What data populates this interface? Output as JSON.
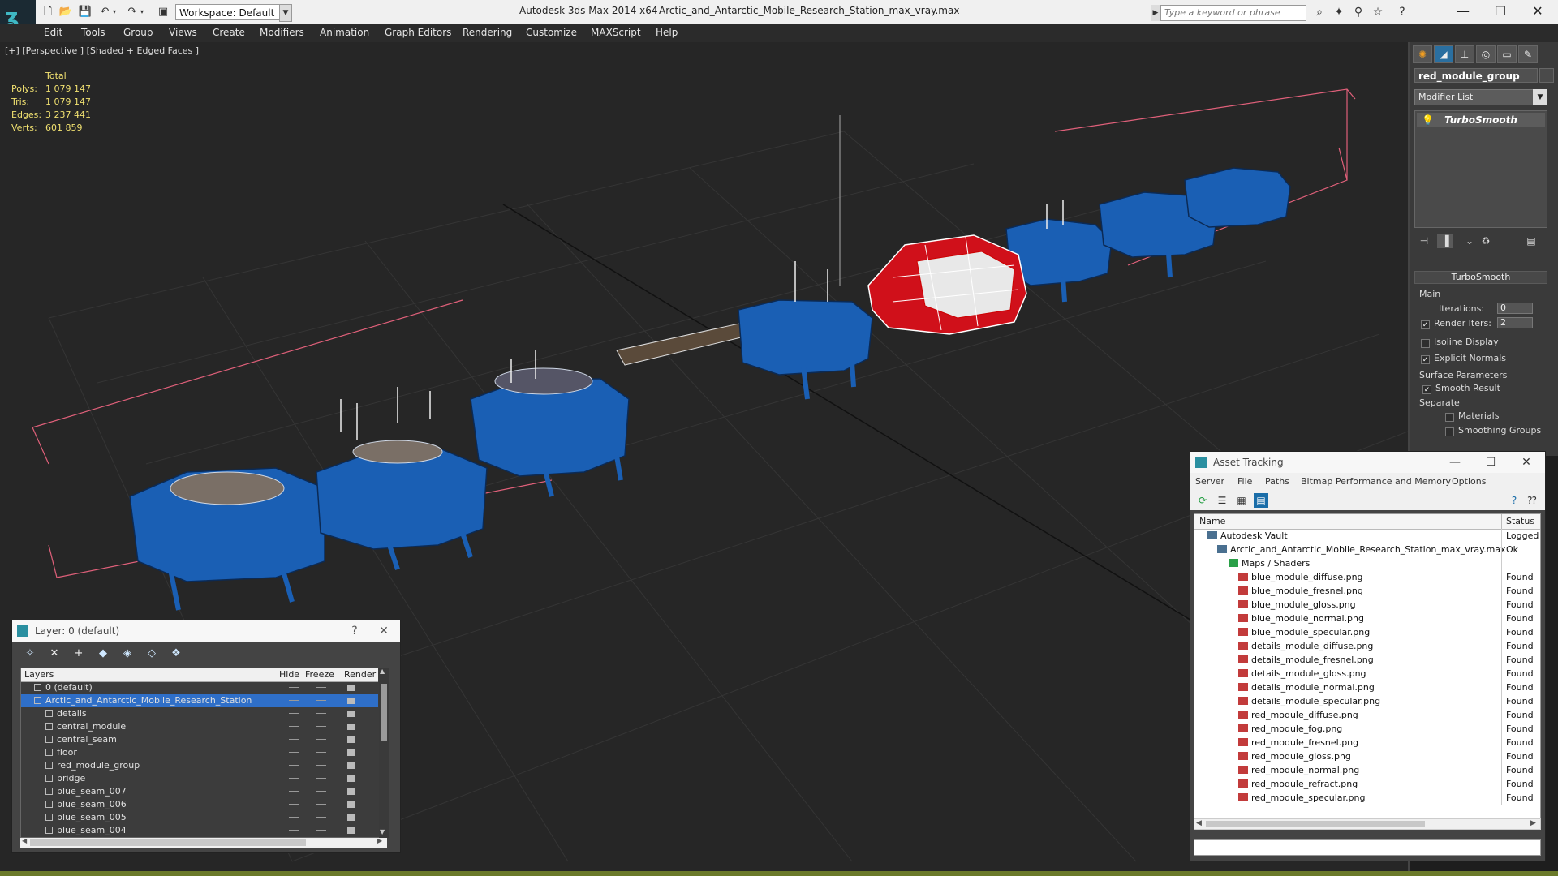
{
  "titlebar": {
    "workspace": "Workspace: Default",
    "app_title": "Autodesk 3ds Max  2014 x64",
    "doc_title": "Arctic_and_Antarctic_Mobile_Research_Station_max_vray.max",
    "search_placeholder": "Type a keyword or phrase",
    "minimize": "—",
    "maximize": "☐",
    "close": "✕"
  },
  "menu": [
    "Edit",
    "Tools",
    "Group",
    "Views",
    "Create",
    "Modifiers",
    "Animation",
    "Graph Editors",
    "Rendering",
    "Customize",
    "MAXScript",
    "Help"
  ],
  "viewport": {
    "label": "[+] [Perspective ] [Shaded + Edged Faces ]",
    "stats_header": "Total",
    "stats": [
      {
        "label": "Polys:",
        "value": "1 079 147"
      },
      {
        "label": "Tris:",
        "value": "1 079 147"
      },
      {
        "label": "Edges:",
        "value": "3 237 441"
      },
      {
        "label": "Verts:",
        "value": "601 859"
      }
    ],
    "colors": {
      "blue_module": "#1a5fb4",
      "red_module": "#d0101a",
      "selection_box": "#e0607a",
      "grid": "#3a3a3a"
    }
  },
  "command_panel": {
    "object_name": "red_module_group",
    "modifier_list": "Modifier List",
    "stack_item": "TurboSmooth",
    "rollout_title": "TurboSmooth",
    "main_group": "Main",
    "iterations_label": "Iterations:",
    "iterations_value": "0",
    "render_iters_label": "Render Iters:",
    "render_iters_value": "2",
    "isoline_label": "Isoline Display",
    "explicit_normals_label": "Explicit Normals",
    "surface_group": "Surface Parameters",
    "smooth_result_label": "Smooth Result",
    "separate_label": "Separate",
    "materials_label": "Materials",
    "smoothing_groups_label": "Smoothing Groups"
  },
  "asset_tracking": {
    "title": "Asset Tracking",
    "menu": [
      "Server",
      "File",
      "Paths",
      "Bitmap Performance and Memory",
      "Options"
    ],
    "col_name": "Name",
    "col_status": "Status",
    "rows": [
      {
        "name": "Autodesk Vault",
        "status": "Logged",
        "level": 0
      },
      {
        "name": "Arctic_and_Antarctic_Mobile_Research_Station_max_vray.max",
        "status": "Ok",
        "level": 1
      },
      {
        "name": "Maps / Shaders",
        "status": "",
        "level": 2
      },
      {
        "name": "blue_module_diffuse.png",
        "status": "Found",
        "level": 3
      },
      {
        "name": "blue_module_fresnel.png",
        "status": "Found",
        "level": 3
      },
      {
        "name": "blue_module_gloss.png",
        "status": "Found",
        "level": 3
      },
      {
        "name": "blue_module_normal.png",
        "status": "Found",
        "level": 3
      },
      {
        "name": "blue_module_specular.png",
        "status": "Found",
        "level": 3
      },
      {
        "name": "details_module_diffuse.png",
        "status": "Found",
        "level": 3
      },
      {
        "name": "details_module_fresnel.png",
        "status": "Found",
        "level": 3
      },
      {
        "name": "details_module_gloss.png",
        "status": "Found",
        "level": 3
      },
      {
        "name": "details_module_normal.png",
        "status": "Found",
        "level": 3
      },
      {
        "name": "details_module_specular.png",
        "status": "Found",
        "level": 3
      },
      {
        "name": "red_module_diffuse.png",
        "status": "Found",
        "level": 3
      },
      {
        "name": "red_module_fog.png",
        "status": "Found",
        "level": 3
      },
      {
        "name": "red_module_fresnel.png",
        "status": "Found",
        "level": 3
      },
      {
        "name": "red_module_gloss.png",
        "status": "Found",
        "level": 3
      },
      {
        "name": "red_module_normal.png",
        "status": "Found",
        "level": 3
      },
      {
        "name": "red_module_refract.png",
        "status": "Found",
        "level": 3
      },
      {
        "name": "red_module_specular.png",
        "status": "Found",
        "level": 3
      }
    ]
  },
  "layers": {
    "title": "Layer: 0 (default)",
    "help": "?",
    "close": "✕",
    "col_layers": "Layers",
    "col_hide": "Hide",
    "col_freeze": "Freeze",
    "col_render": "Render",
    "rows": [
      {
        "name": "0 (default)",
        "level": 0,
        "selected": false
      },
      {
        "name": "Arctic_and_Antarctic_Mobile_Research_Station",
        "level": 0,
        "selected": true
      },
      {
        "name": "details",
        "level": 1,
        "selected": false
      },
      {
        "name": "central_module",
        "level": 1,
        "selected": false
      },
      {
        "name": "central_seam",
        "level": 1,
        "selected": false
      },
      {
        "name": "floor",
        "level": 1,
        "selected": false
      },
      {
        "name": "red_module_group",
        "level": 1,
        "selected": false
      },
      {
        "name": "bridge",
        "level": 1,
        "selected": false
      },
      {
        "name": "blue_seam_007",
        "level": 1,
        "selected": false
      },
      {
        "name": "blue_seam_006",
        "level": 1,
        "selected": false
      },
      {
        "name": "blue_seam_005",
        "level": 1,
        "selected": false
      },
      {
        "name": "blue_seam_004",
        "level": 1,
        "selected": false
      }
    ]
  }
}
